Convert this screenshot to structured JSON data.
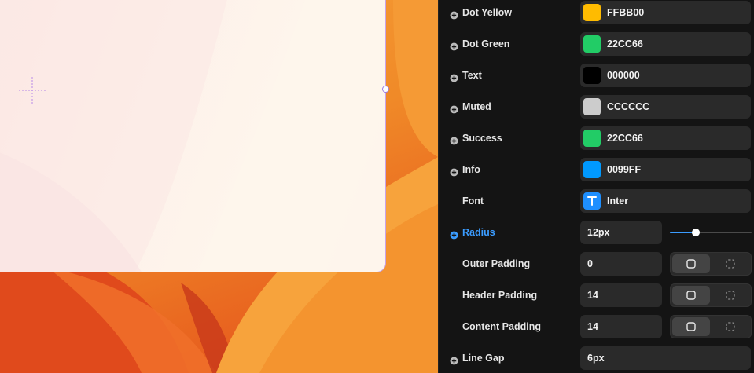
{
  "panel": {
    "rows": [
      {
        "label": "Dot Yellow",
        "kind": "color",
        "has_plus": true,
        "swatch": "#FFBB00",
        "value": "FFBB00"
      },
      {
        "label": "Dot Green",
        "kind": "color",
        "has_plus": true,
        "swatch": "#22CC66",
        "value": "22CC66"
      },
      {
        "label": "Text",
        "kind": "color",
        "has_plus": true,
        "swatch": "#000000",
        "value": "000000"
      },
      {
        "label": "Muted",
        "kind": "color",
        "has_plus": true,
        "swatch": "#CCCCCC",
        "value": "CCCCCC"
      },
      {
        "label": "Success",
        "kind": "color",
        "has_plus": true,
        "swatch": "#22CC66",
        "value": "22CC66"
      },
      {
        "label": "Info",
        "kind": "color",
        "has_plus": true,
        "swatch": "#0099FF",
        "value": "0099FF"
      },
      {
        "label": "Font",
        "kind": "font",
        "has_plus": false,
        "value": "Inter"
      },
      {
        "label": "Radius",
        "kind": "slider",
        "has_plus": true,
        "active": true,
        "value": "12px",
        "slider_fraction": 0.32
      },
      {
        "label": "Outer Padding",
        "kind": "padding",
        "has_plus": false,
        "value": "0",
        "mode": "uniform"
      },
      {
        "label": "Header Padding",
        "kind": "padding",
        "has_plus": false,
        "value": "14",
        "mode": "uniform"
      },
      {
        "label": "Content Padding",
        "kind": "padding",
        "has_plus": false,
        "value": "14",
        "mode": "uniform"
      },
      {
        "label": "Line Gap",
        "kind": "text",
        "has_plus": true,
        "value": "6px"
      }
    ],
    "padding_modes": [
      "uniform-padding-icon",
      "individual-padding-icon"
    ],
    "accent_color": "#3b9cff"
  },
  "canvas": {
    "frame_background": "#FDF1EA",
    "wallpaper": "orange-gradient"
  }
}
